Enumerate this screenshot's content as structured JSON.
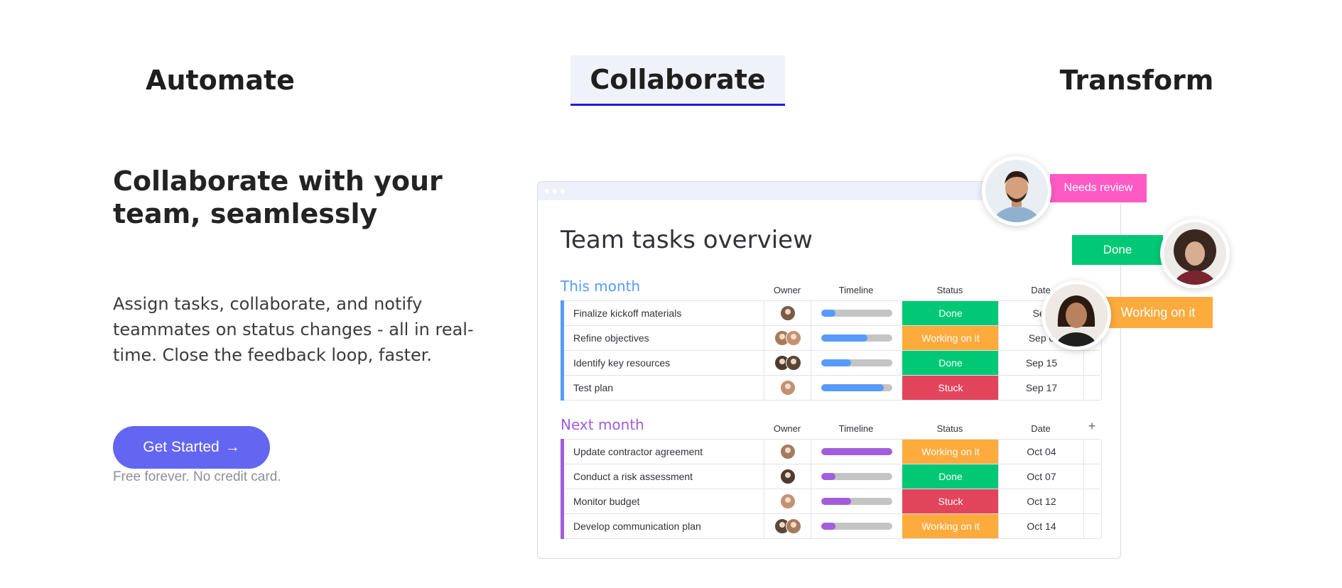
{
  "tabs": [
    {
      "label": "Automate"
    },
    {
      "label": "Collaborate",
      "active": true
    },
    {
      "label": "Transform"
    }
  ],
  "hero": {
    "headline": "Collaborate with your team, seamlessly",
    "description": "Assign tasks, collaborate, and notify teammates on status changes - all in real-time. Close the feedback loop, faster.",
    "cta_label": "Get Started",
    "cta_arrow": "→",
    "note": "Free forever. No credit card."
  },
  "board": {
    "title": "Team tasks overview",
    "columns": {
      "owner": "Owner",
      "timeline": "Timeline",
      "status": "Status",
      "date": "Date",
      "add": "+"
    },
    "groups": [
      {
        "title": "This month",
        "rows": [
          {
            "name": "Finalize kickoff materials",
            "owners": 1,
            "progress": 0.2,
            "status": "Done",
            "date": "Sep"
          },
          {
            "name": "Refine objectives",
            "owners": 2,
            "progress": 0.65,
            "status": "Working on it",
            "date": "Sep 0"
          },
          {
            "name": "Identify key resources",
            "owners": 2,
            "progress": 0.42,
            "status": "Done",
            "date": "Sep 15"
          },
          {
            "name": "Test plan",
            "owners": 1,
            "progress": 0.88,
            "status": "Stuck",
            "date": "Sep 17"
          }
        ]
      },
      {
        "title": "Next month",
        "rows": [
          {
            "name": "Update contractor agreement",
            "owners": 1,
            "progress": 1.0,
            "status": "Working on it",
            "date": "Oct 04"
          },
          {
            "name": "Conduct a risk assessment",
            "owners": 1,
            "progress": 0.2,
            "status": "Done",
            "date": "Oct 07"
          },
          {
            "name": "Monitor budget",
            "owners": 1,
            "progress": 0.42,
            "status": "Stuck",
            "date": "Oct 12"
          },
          {
            "name": "Develop communication plan",
            "owners": 2,
            "progress": 0.2,
            "status": "Working on it",
            "date": "Oct 14"
          }
        ]
      }
    ]
  },
  "status_colors": {
    "Done": "#00c875",
    "Working on it": "#fdab3d",
    "Stuck": "#e2445c",
    "Needs review": "#ff5ac4"
  },
  "floating": [
    {
      "label": "Needs review"
    },
    {
      "label": "Done"
    },
    {
      "label": "Working on it"
    }
  ]
}
